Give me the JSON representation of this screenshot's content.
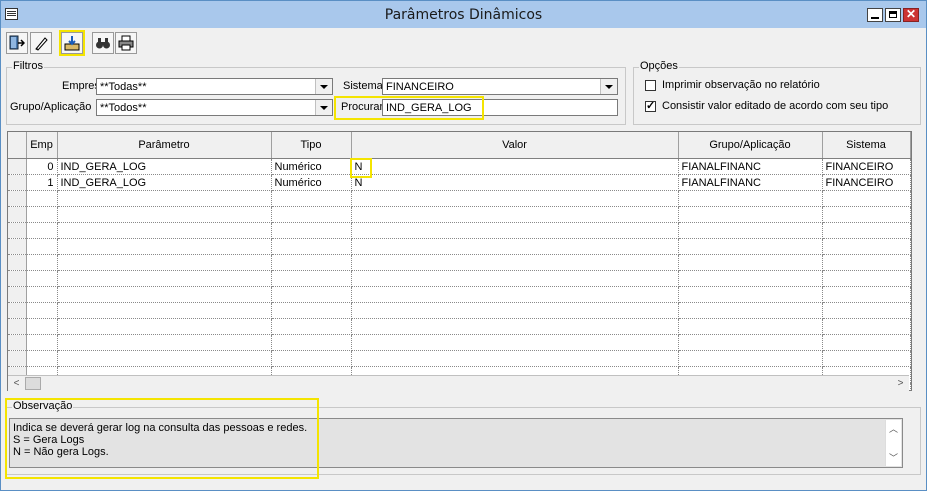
{
  "window": {
    "title": "Parâmetros Dinâmicos"
  },
  "toolbar": {
    "buttons": [
      "exit-icon",
      "eraser-icon",
      "import-icon",
      "binoculars-icon",
      "printer-icon"
    ]
  },
  "filters": {
    "legend": "Filtros",
    "empresa_label": "Empresa",
    "empresa_value": "**Todas**",
    "grupo_label": "Grupo/Aplicação",
    "grupo_value": "**Todos**",
    "sistema_label": "Sistema",
    "sistema_value": "FINANCEIRO",
    "procurar_label": "Procurar",
    "procurar_value": "IND_GERA_LOG"
  },
  "options": {
    "legend": "Opções",
    "opt1_label": "Imprimir observação no relatório",
    "opt1_checked": false,
    "opt2_label": "Consistir valor editado de acordo com seu tipo",
    "opt2_checked": true
  },
  "grid": {
    "columns": [
      "Emp",
      "Parâmetro",
      "Tipo",
      "Valor",
      "Grupo/Aplicação",
      "Sistema"
    ],
    "rows": [
      [
        "0",
        "IND_GERA_LOG",
        "Numérico",
        "N",
        "FIANALFINANC",
        "FINANCEIRO"
      ],
      [
        "1",
        "IND_GERA_LOG",
        "Numérico",
        "N",
        "FIANALFINANC",
        "FINANCEIRO"
      ]
    ]
  },
  "observacao": {
    "legend": "Observação",
    "line1": "Indica se deverá gerar log na consulta das pessoas e redes.",
    "line2": "S = Gera Logs",
    "line3": "N = Não gera Logs."
  },
  "colors": {
    "highlight": "#f4e400",
    "titlebar": "#a9c8ec"
  }
}
